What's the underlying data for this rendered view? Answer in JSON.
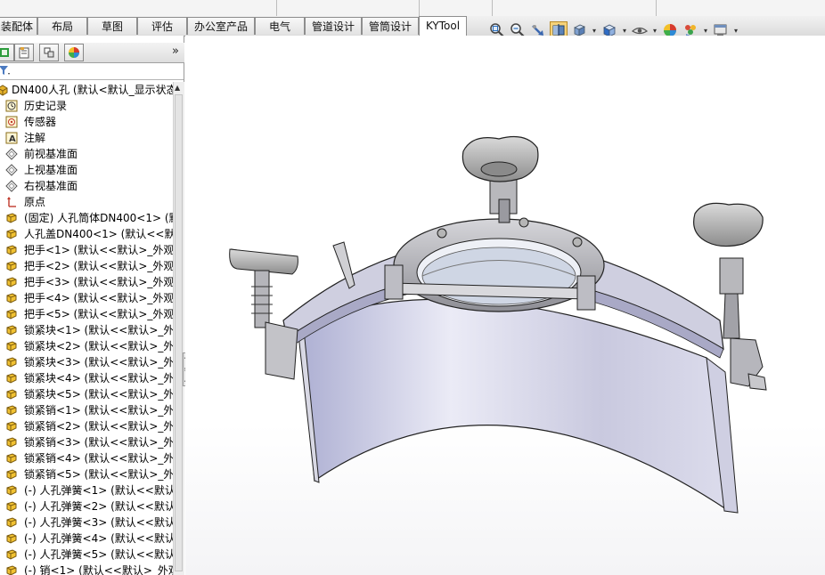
{
  "command_manager": {
    "tabs": [
      {
        "label": "装配体",
        "active": false
      },
      {
        "label": "布局",
        "active": false
      },
      {
        "label": "草图",
        "active": false
      },
      {
        "label": "评估",
        "active": false
      },
      {
        "label": "办公室产品",
        "active": false
      },
      {
        "label": "电气",
        "active": false
      },
      {
        "label": "管道设计",
        "active": false
      },
      {
        "label": "管筒设计",
        "active": false
      },
      {
        "label": "KYTool",
        "active": true
      }
    ]
  },
  "view_toolbar": {
    "icons": [
      "zoom-to-fit-icon",
      "zoom-to-area-icon",
      "previous-view-icon",
      "section-view-icon",
      "view-orientation-icon",
      "display-style-icon",
      "hide-show-items-icon",
      "edit-appearance-icon",
      "apply-scene-icon",
      "view-settings-icon"
    ],
    "selected": "section-view-icon"
  },
  "feature_manager": {
    "panel_tabs": [
      "featuremanager-tree-icon",
      "property-manager-icon",
      "configuration-manager-icon",
      "display-manager-icon"
    ],
    "expand_label": "»",
    "filter_icon": "filter-icon",
    "items": [
      {
        "label": "DN400人孔  (默认<默认_显示状态",
        "icon": "assembly-icon"
      },
      {
        "label": "历史记录",
        "icon": "history-icon"
      },
      {
        "label": "传感器",
        "icon": "sensor-icon"
      },
      {
        "label": "注解",
        "icon": "annotation-icon"
      },
      {
        "label": "前视基准面",
        "icon": "plane-icon"
      },
      {
        "label": "上视基准面",
        "icon": "plane-icon"
      },
      {
        "label": "右视基准面",
        "icon": "plane-icon"
      },
      {
        "label": "原点",
        "icon": "origin-icon"
      },
      {
        "label": "(固定) 人孔筒体DN400<1> (默",
        "icon": "part-icon"
      },
      {
        "label": "人孔盖DN400<1> (默认<<默认",
        "icon": "part-icon"
      },
      {
        "label": "把手<1> (默认<<默认>_外观",
        "icon": "part-icon"
      },
      {
        "label": "把手<2> (默认<<默认>_外观",
        "icon": "part-icon"
      },
      {
        "label": "把手<3> (默认<<默认>_外观",
        "icon": "part-icon"
      },
      {
        "label": "把手<4> (默认<<默认>_外观",
        "icon": "part-icon"
      },
      {
        "label": "把手<5> (默认<<默认>_外观",
        "icon": "part-icon"
      },
      {
        "label": "锁紧块<1> (默认<<默认>_外观",
        "icon": "part-icon"
      },
      {
        "label": "锁紧块<2> (默认<<默认>_外观",
        "icon": "part-icon"
      },
      {
        "label": "锁紧块<3> (默认<<默认>_外观",
        "icon": "part-icon"
      },
      {
        "label": "锁紧块<4> (默认<<默认>_外观",
        "icon": "part-icon"
      },
      {
        "label": "锁紧块<5> (默认<<默认>_外观",
        "icon": "part-icon"
      },
      {
        "label": "锁紧销<1> (默认<<默认>_外观",
        "icon": "part-icon"
      },
      {
        "label": "锁紧销<2> (默认<<默认>_外观",
        "icon": "part-icon"
      },
      {
        "label": "锁紧销<3> (默认<<默认>_外观",
        "icon": "part-icon"
      },
      {
        "label": "锁紧销<4> (默认<<默认>_外观",
        "icon": "part-icon"
      },
      {
        "label": "锁紧销<5> (默认<<默认>_外观",
        "icon": "part-icon"
      },
      {
        "label": "(-) 人孔弹簧<1> (默认<<默认",
        "icon": "part-icon"
      },
      {
        "label": "(-) 人孔弹簧<2> (默认<<默认",
        "icon": "part-icon"
      },
      {
        "label": "(-) 人孔弹簧<3> (默认<<默认",
        "icon": "part-icon"
      },
      {
        "label": "(-) 人孔弹簧<4> (默认<<默认",
        "icon": "part-icon"
      },
      {
        "label": "(-) 人孔弹簧<5> (默认<<默认",
        "icon": "part-icon"
      },
      {
        "label": "(-) 销<1> (默认<<默认>_外观",
        "icon": "part-icon"
      }
    ]
  },
  "graphics_area": {
    "model_name": "DN400人孔",
    "model_icon": "manhole-assembly-render"
  }
}
